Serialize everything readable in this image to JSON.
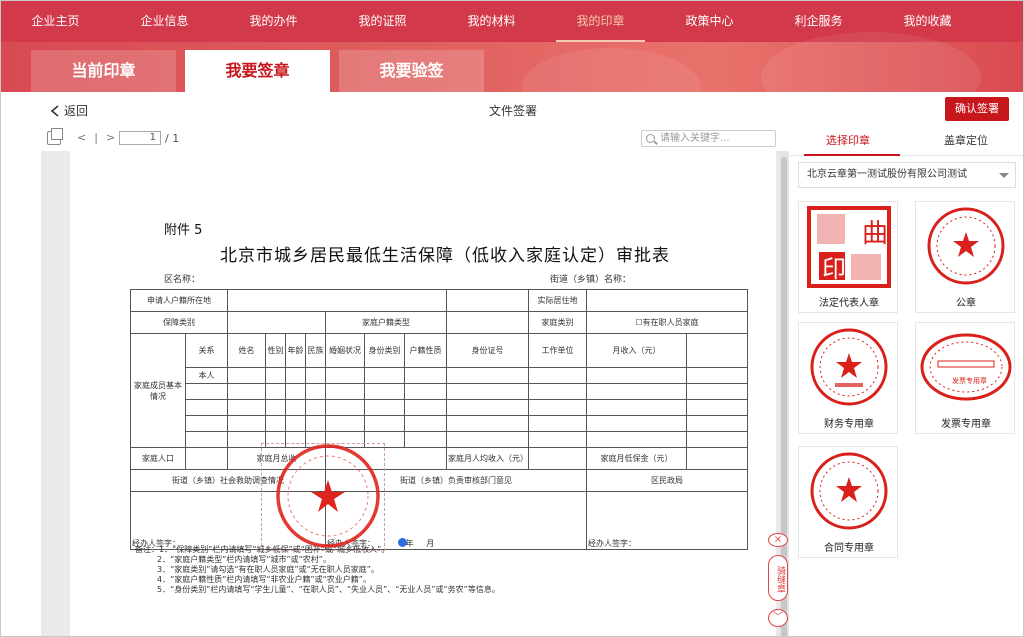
{
  "nav": [
    "企业主页",
    "企业信息",
    "我的办件",
    "我的证照",
    "我的材料",
    "我的印章",
    "政策中心",
    "利企服务",
    "我的收藏"
  ],
  "nav_active": 5,
  "tabs": [
    "当前印章",
    "我要签章",
    "我要验签"
  ],
  "tab_active": 1,
  "header": {
    "back": "返回",
    "title": "文件签署",
    "confirm": "确认签署"
  },
  "viewer": {
    "page_current": "1",
    "page_total": "/ 1",
    "search_placeholder": "请输入关键字..."
  },
  "document": {
    "attachment": "附件 5",
    "title": "北京市城乡居民最低生活保障（低收入家庭认定）审批表",
    "district_label": "区名称：",
    "street_label": "街道（乡镇）名称：",
    "rows": {
      "applicant_address": "申请人户籍所在地",
      "residence": "实际居住地",
      "guarantee_type": "保障类别",
      "household_type": "家庭户籍类型",
      "family_type": "家庭类别",
      "employed_option": "☐有在职人员家庭",
      "relation": "关系",
      "name": "姓名",
      "gender": "性别",
      "age": "年龄",
      "ethnicity": "民族",
      "marital": "婚姻状况",
      "identity_type": "身份类别",
      "hukou_nature": "户籍性质",
      "id_number": "身份证号",
      "work_unit": "工作单位",
      "monthly_income": "月收入（元）",
      "self": "本人",
      "member_info": "家庭成员基本情况",
      "population": "家庭人口",
      "monthly_total": "家庭月总收",
      "per_capita": "家庭月人均收入（元）",
      "allowance": "家庭月低保金（元）",
      "street_survey": "街道（乡镇）社会救助调查情况",
      "street_opinion": "街道（乡镇）负责审核部门意见",
      "district_dept": "区民政局",
      "handler1": "经办人签字：",
      "handler2": "经办人签字：",
      "handler3": "经办人签字：",
      "year": "年",
      "month": "月"
    },
    "notes": [
      "备注：1．“保障类别”栏内请填写“城乡低保”或“困补”或“城乡低收入”。",
      "2．“家庭户籍类型”栏内请填写“城市”或“农村”。",
      "3．“家庭类别”请勾选“有在职人员家庭”或“无在职人员家庭”。",
      "4．“家庭户籍性质”栏内请填写“非农业户籍”或“农业户籍”。",
      "5．“身份类别”栏内请填写“学生儿童”、“在职人员”、“失业人员”、“无业人员”或“务农”等信息。"
    ]
  },
  "side_buttons": {
    "ride": "骑缝章",
    "down": "﹀"
  },
  "panel": {
    "tabs": [
      "选择印章",
      "盖章定位"
    ],
    "company": "北京云章第一测试股份有限公司测试",
    "seals": [
      {
        "label": "法定代表人章",
        "text_top": "曲",
        "text_bottom": "印"
      },
      {
        "label": "公章"
      },
      {
        "label": "财务专用章"
      },
      {
        "label": "发票专用章",
        "inner_text": "发票专用章"
      },
      {
        "label": "合同专用章"
      }
    ]
  },
  "colors": {
    "primary": "#c8161d",
    "nav": "#d2394a"
  }
}
